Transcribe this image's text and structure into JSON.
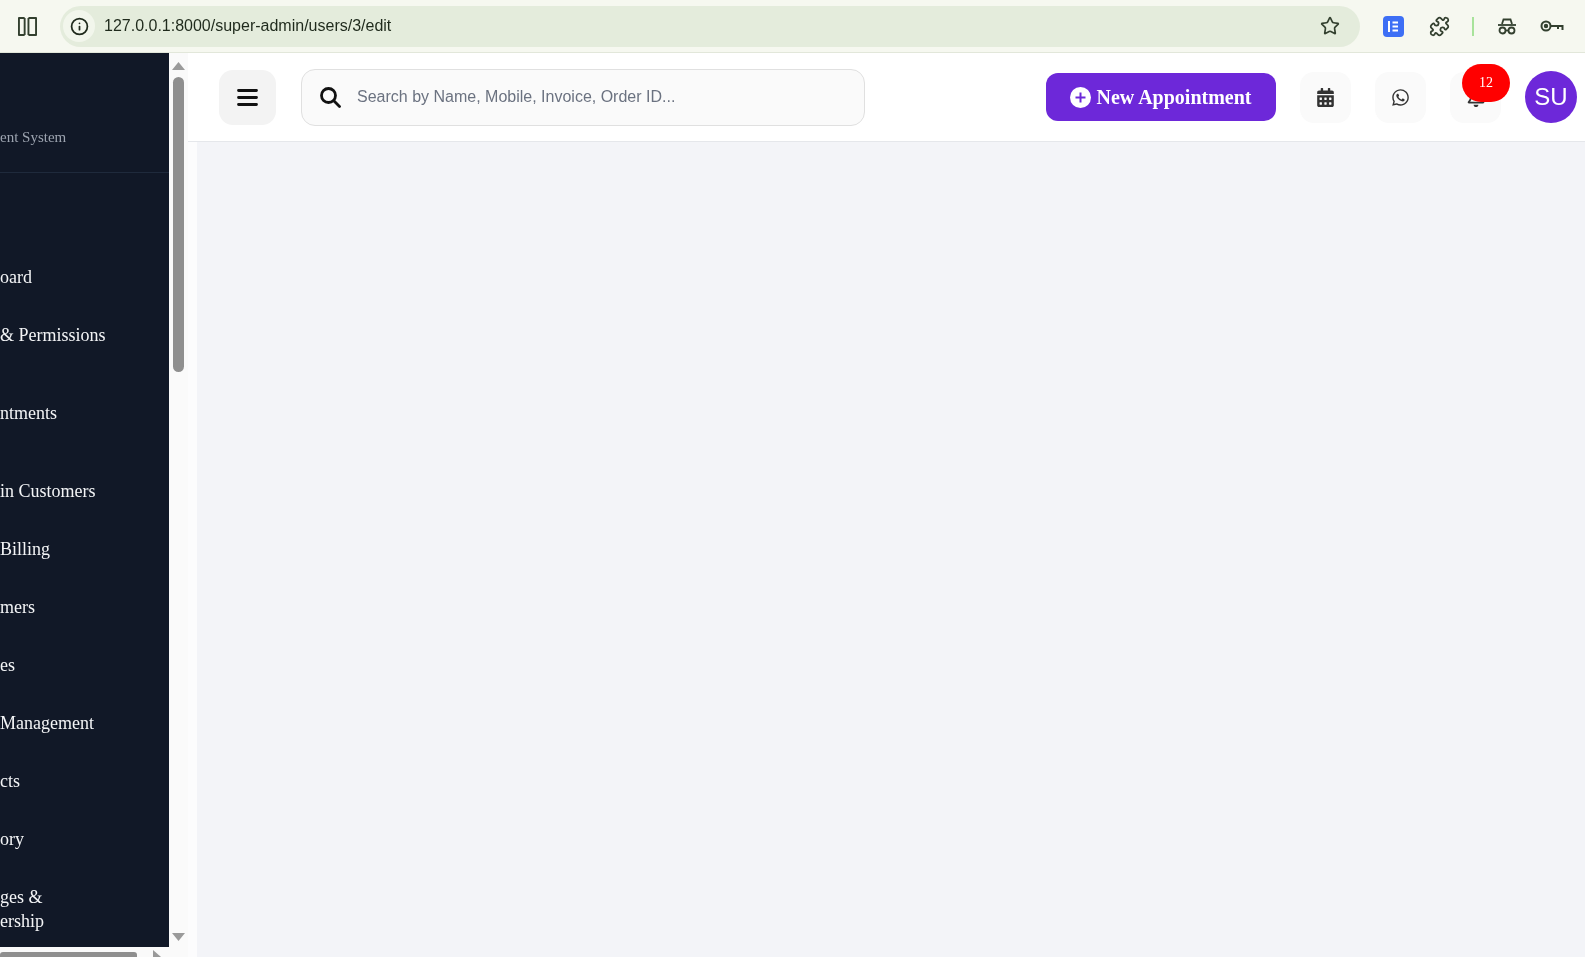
{
  "browser": {
    "url": "127.0.0.1:8000/super-admin/users/3/edit"
  },
  "sidebar": {
    "subtitle": "ent System",
    "groups": [
      {
        "items": [
          "oard",
          "& Permissions"
        ]
      },
      {
        "items": [
          "ntments"
        ]
      },
      {
        "items": [
          "in Customers",
          "Billing",
          "mers",
          "es",
          "Management",
          "cts",
          "ory",
          "ges &\nership"
        ]
      }
    ]
  },
  "header": {
    "search": {
      "placeholder": "Search by Name, Mobile, Invoice, Order ID..."
    },
    "new_appointment": "New Appointment",
    "notification_count": "12",
    "avatar": "SU"
  }
}
